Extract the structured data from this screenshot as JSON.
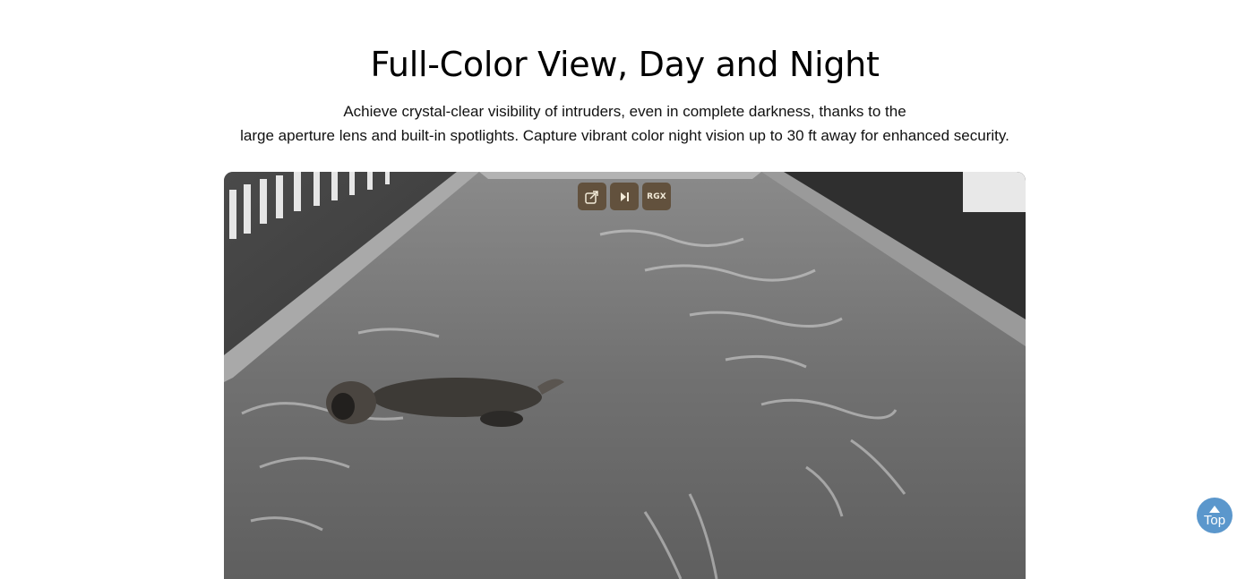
{
  "section": {
    "title": "Full-Color View, Day and Night",
    "subtitle_line1": "Achieve crystal-clear visibility of intruders, even in complete darkness, thanks to the",
    "subtitle_line2": "large aperture lens and built-in spotlights. Capture vibrant color night vision up to 30 ft away for enhanced security."
  },
  "video": {
    "description_icon": "video-frame",
    "controls": [
      {
        "name": "popout-button",
        "icon": "popout-icon"
      },
      {
        "name": "play-pause-button",
        "icon": "play-pause-icon"
      },
      {
        "name": "rgx-button",
        "label": "RGX"
      }
    ]
  },
  "back_to_top": {
    "label": "Top",
    "icon": "arrow-up-icon",
    "color": "#5b97cc"
  }
}
